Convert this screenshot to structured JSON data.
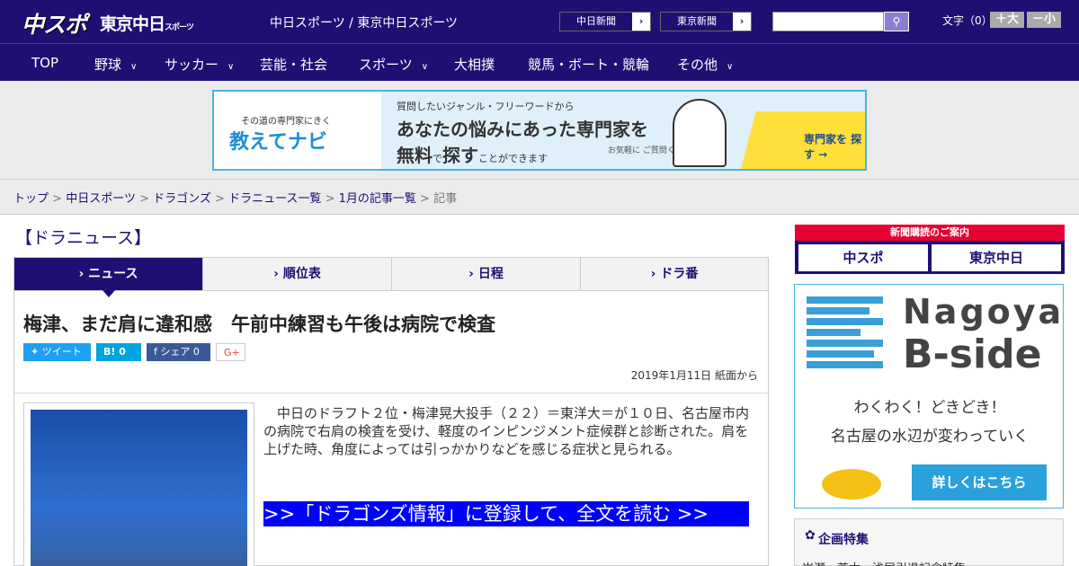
{
  "header": {
    "logo_main": "中スポ",
    "logo_sub": "東京中日",
    "logo_sub_small": "スポーツ",
    "site_title": "中日スポーツ / 東京中日スポーツ",
    "btn1": "中日新聞",
    "btn2": "東京新聞",
    "font_label": "文字（0）",
    "font_up": "＋大",
    "font_down": "－小",
    "colors": {
      "brand": "#1f0f73",
      "accent": "#00f"
    }
  },
  "nav": {
    "items": [
      "TOP",
      "野球",
      "サッカー",
      "芸能・社会",
      "スポーツ",
      "大相撲",
      "競馬・ボート・競輪",
      "その他"
    ]
  },
  "banner": {
    "small": "その道の専門家にきく",
    "brand": "教えてナビ",
    "q": "質問したいジャンル・フリーワードから",
    "h1": "あなたの悩みにあった専門家を",
    "h2a": "無料",
    "h2b": "で",
    "h2c": "探す",
    "h2d": "ことができます",
    "note": "お気軽に ご質問ください!",
    "cta": "専門家を 探す →"
  },
  "breadcrumb": {
    "items": [
      "トップ",
      "中日スポーツ",
      "ドラゴンズ",
      "ドラニュース一覧",
      "1月の記事一覧"
    ],
    "current": "記事",
    "sep": ">"
  },
  "section": "【ドラニュース】",
  "tabs": [
    "ニュース",
    "順位表",
    "日程",
    "ドラ番"
  ],
  "article": {
    "title": "梅津、まだ肩に違和感　午前中練習も午後は病院で検査",
    "share": {
      "tweet": "ツイート",
      "hatena": "B! 0",
      "fb": "シェア 0",
      "gplus": "G+"
    },
    "date": "2019年1月11日 紙面から",
    "body": "中日のドラフト２位・梅津晃大投手（２２）＝東洋大＝が１０日、名古屋市内の病院で右肩の検査を受け、軽度のインピンジメント症候群と診断された。肩を上げた時、角度によっては引っかかりなどを感じる症状と見られる。",
    "cta": ">>「ドラゴンズ情報」に登録して、全文を読む >>"
  },
  "sidebar": {
    "sub_head": "新聞購読のご案内",
    "sub_b1": "中スポ",
    "sub_b2": "東京中日",
    "ad_nagoya": "Nagoya",
    "ad_bside": "B-side",
    "ad_t1": "わくわく！どきどき！",
    "ad_t2": "名古屋の水辺が変わっていく",
    "ad_btn": "詳しくはこちら",
    "kikaku": "企画特集",
    "kikaku_row": "岩瀬・荒木・浅尾引退記念特集"
  }
}
